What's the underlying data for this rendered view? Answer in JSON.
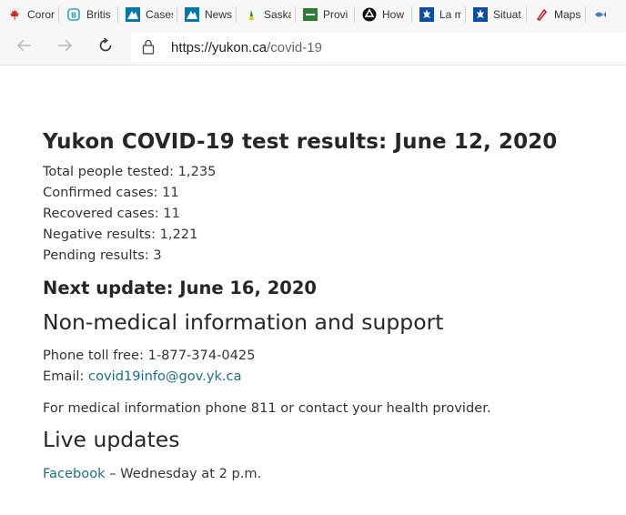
{
  "bookmarks": [
    {
      "label": "Coror",
      "icon": "maple-leaf-icon",
      "color": "#d52b1e"
    },
    {
      "label": "Britis",
      "icon": "bc-logo-icon",
      "color": "#29a6c9"
    },
    {
      "label": "Cases",
      "icon": "alberta-logo-icon",
      "color": "#0078a8"
    },
    {
      "label": "News",
      "icon": "alberta-logo-icon",
      "color": "#0078a8"
    },
    {
      "label": "Saska",
      "icon": "saskatchewan-icon",
      "color": "#e6c421"
    },
    {
      "label": "Provi",
      "icon": "manitoba-icon",
      "color": "#2e7d32"
    },
    {
      "label": "How",
      "icon": "ontario-trillium-icon",
      "color": "#111111"
    },
    {
      "label": "La ma",
      "icon": "quebec-fleur-icon",
      "color": "#0b4ea2"
    },
    {
      "label": "Situat",
      "icon": "quebec-fleur-icon",
      "color": "#0b4ea2"
    },
    {
      "label": "Maps",
      "icon": "nb-pen-icon",
      "color": "#b71c1c"
    }
  ],
  "toolbar": {
    "url_main": "https://yukon.ca",
    "url_path": "/covid-19"
  },
  "page": {
    "title": "Yukon COVID-19 test results: June 12, 2020",
    "stats": [
      "Total people tested: 1,235",
      "Confirmed cases: 11",
      "Recovered cases: 11",
      "Negative results: 1,221",
      "Pending results: 3"
    ],
    "next_update": "Next update: June 16, 2020",
    "support_heading": "Non-medical information and support",
    "phone": "Phone toll free: 1-877-374-0425",
    "email_label": "Email: ",
    "email_link": "covid19info@gov.yk.ca",
    "medical_note": "For medical information phone 811 or contact your health provider.",
    "live_heading": "Live updates",
    "facebook_link": "Facebook",
    "facebook_note": " – Wednesday at 2 p.m."
  }
}
